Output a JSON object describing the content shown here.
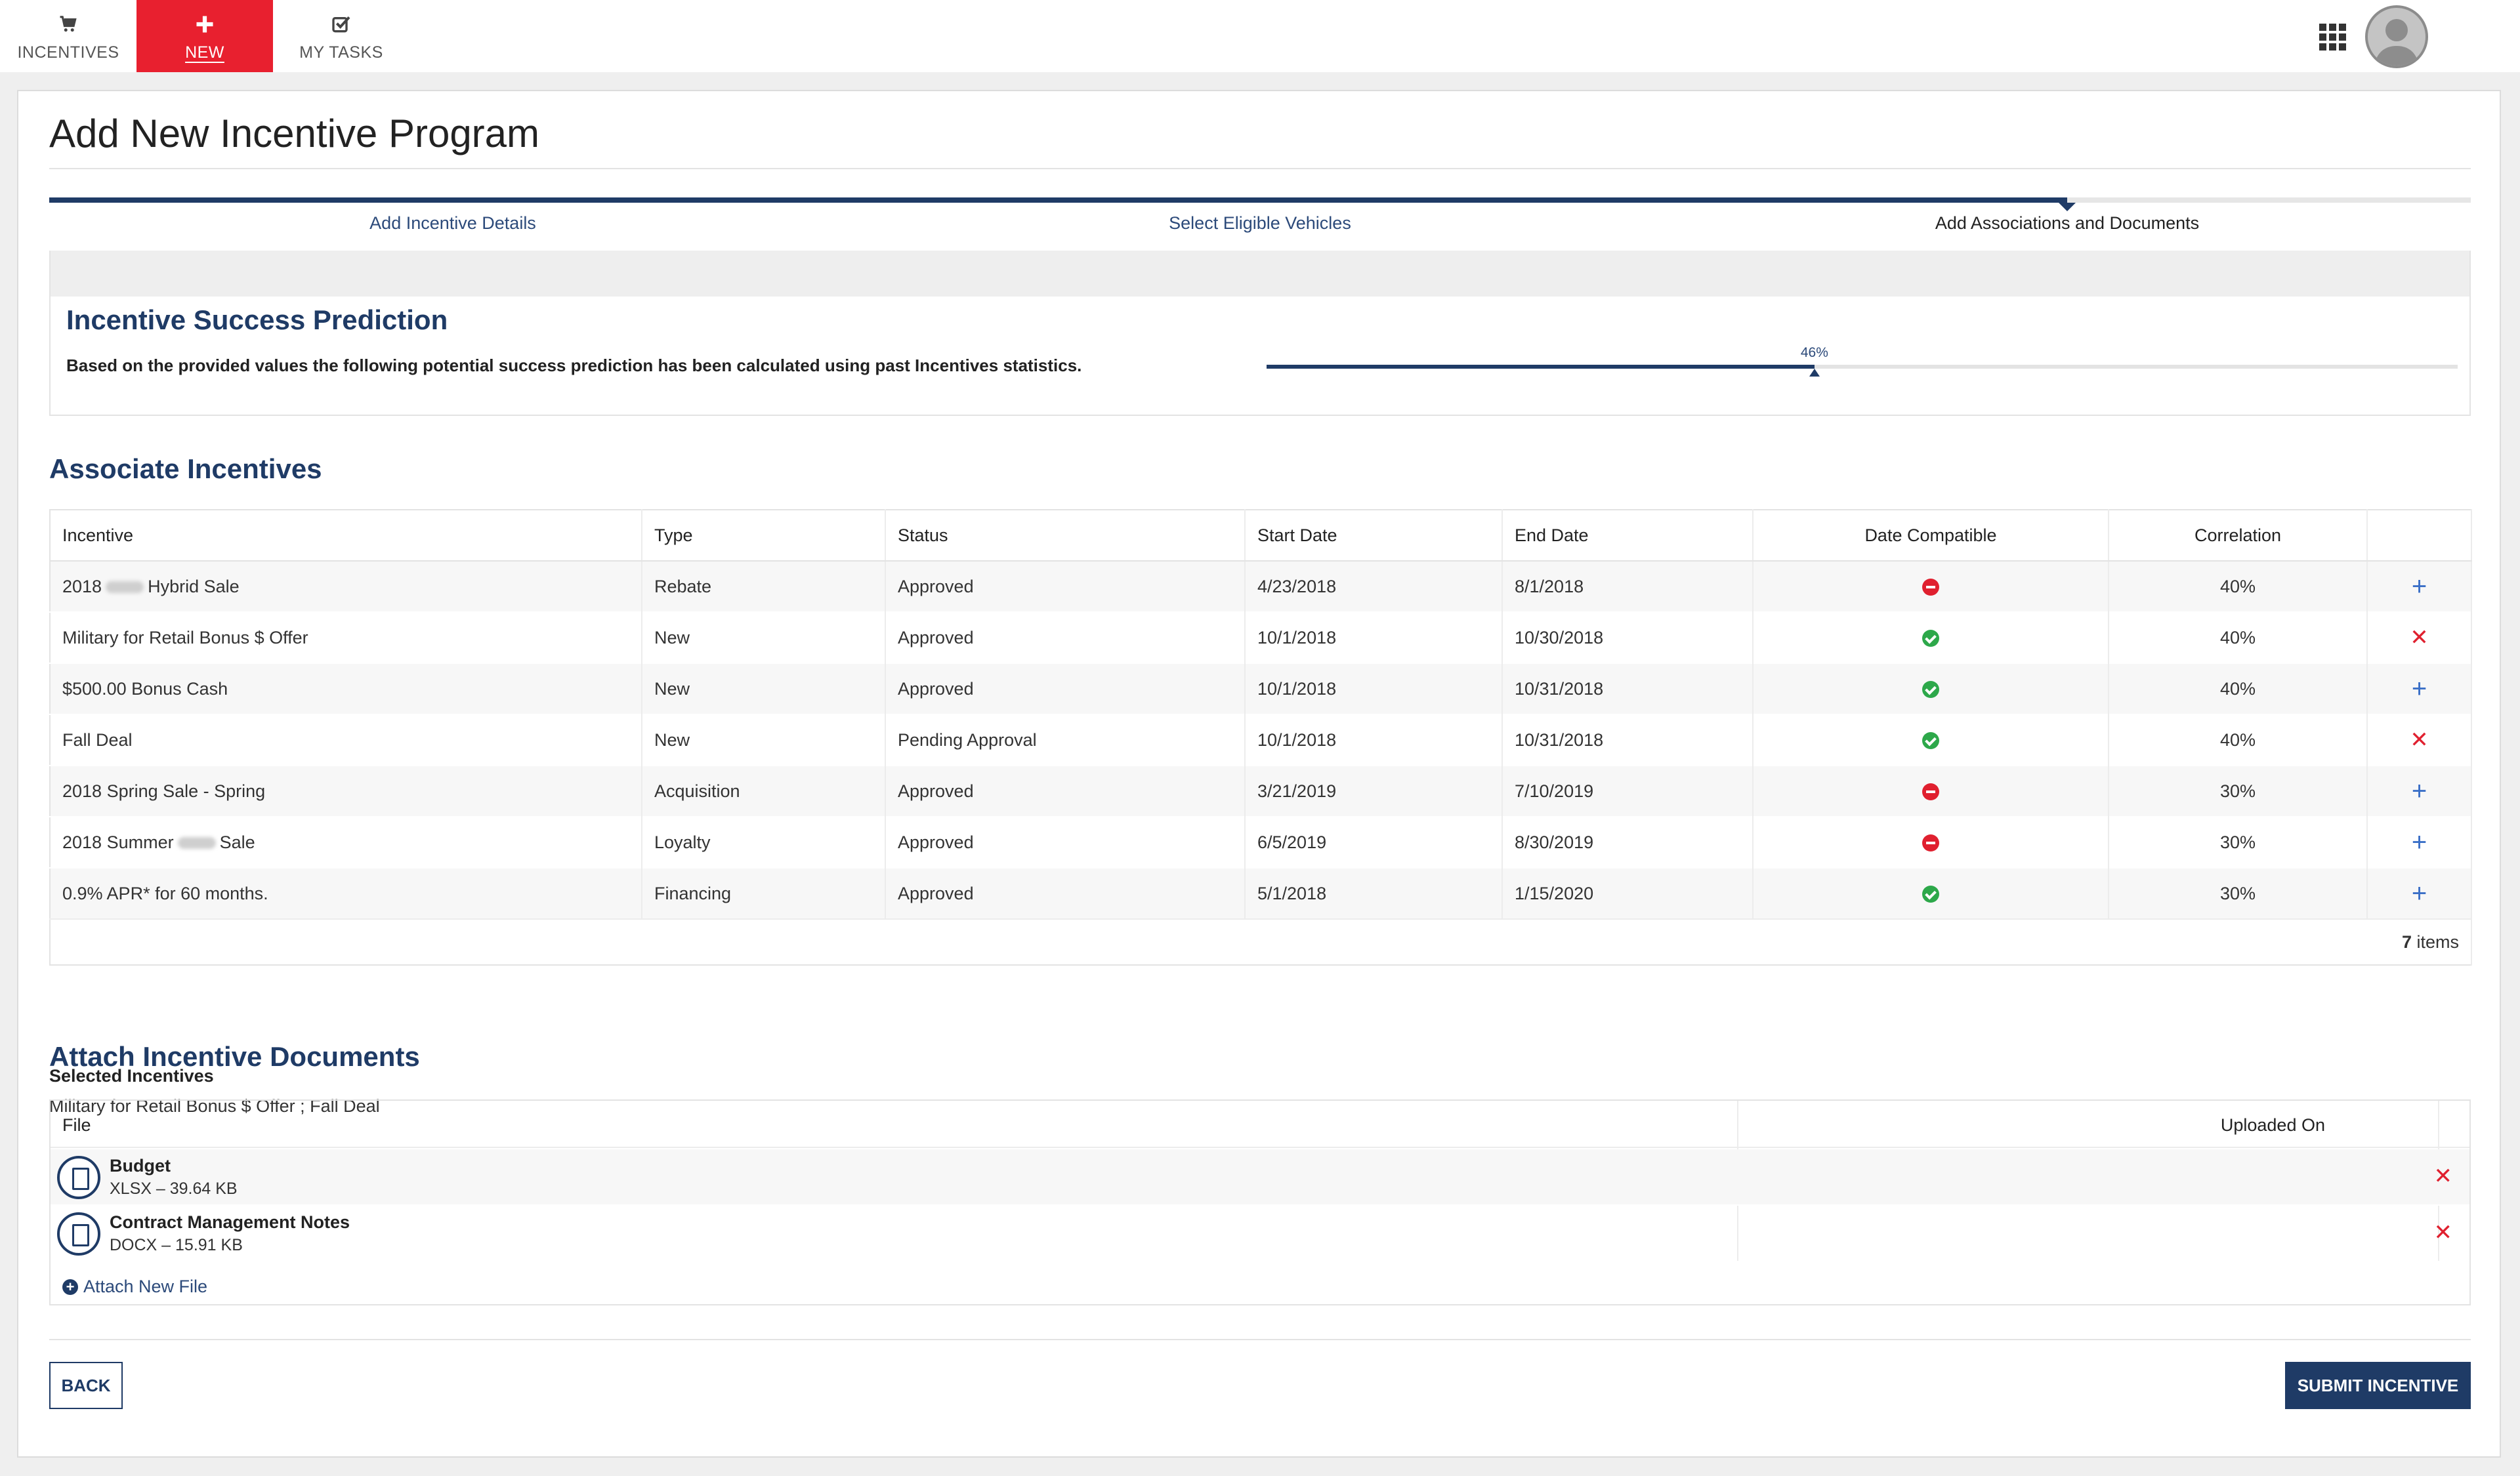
{
  "nav": {
    "tabs": [
      {
        "label": "INCENTIVES",
        "icon": "cart-icon",
        "active": false
      },
      {
        "label": "NEW",
        "icon": "plus-icon",
        "active": true
      },
      {
        "label": "MY TASKS",
        "icon": "checkbox-icon",
        "active": false
      }
    ],
    "apps_icon": "grid-icon",
    "avatar_icon": "user-avatar-icon",
    "accent_color": "#e8202f"
  },
  "page": {
    "title": "Add New Incentive Program"
  },
  "stepper": {
    "steps": [
      "Add Incentive Details",
      "Select Eligible Vehicles",
      "Add Associations and Documents"
    ],
    "current_step": 3
  },
  "prediction": {
    "title": "Incentive Success Prediction",
    "text": "Based on the provided values the following potential success prediction has been calculated using past Incentives statistics.",
    "value_label": "46%",
    "value": 0.46
  },
  "associate": {
    "title": "Associate Incentives",
    "columns": [
      "Incentive",
      "Type",
      "Status",
      "Start Date",
      "End Date",
      "Date Compatible",
      "Correlation",
      ""
    ],
    "rows": [
      {
        "name_prefix": "2018",
        "name_suffix": "Hybrid Sale",
        "redacted": true,
        "type": "Rebate",
        "status": "Approved",
        "start": "4/23/2018",
        "end": "8/1/2018",
        "compatible": false,
        "correlation": "40%",
        "action": "add"
      },
      {
        "name_prefix": "Military for Retail Bonus $ Offer",
        "name_suffix": "",
        "redacted": false,
        "type": "New",
        "status": "Approved",
        "start": "10/1/2018",
        "end": "10/30/2018",
        "compatible": true,
        "correlation": "40%",
        "action": "remove"
      },
      {
        "name_prefix": "$500.00 Bonus Cash",
        "name_suffix": "",
        "redacted": false,
        "type": "New",
        "status": "Approved",
        "start": "10/1/2018",
        "end": "10/31/2018",
        "compatible": true,
        "correlation": "40%",
        "action": "add"
      },
      {
        "name_prefix": "Fall Deal",
        "name_suffix": "",
        "redacted": false,
        "type": "New",
        "status": "Pending Approval",
        "start": "10/1/2018",
        "end": "10/31/2018",
        "compatible": true,
        "correlation": "40%",
        "action": "remove"
      },
      {
        "name_prefix": "2018 Spring Sale - Spring",
        "name_suffix": "",
        "redacted": false,
        "type": "Acquisition",
        "status": "Approved",
        "start": "3/21/2019",
        "end": "7/10/2019",
        "compatible": false,
        "correlation": "30%",
        "action": "add"
      },
      {
        "name_prefix": "2018 Summer",
        "name_suffix": "Sale",
        "redacted": true,
        "type": "Loyalty",
        "status": "Approved",
        "start": "6/5/2019",
        "end": "8/30/2019",
        "compatible": false,
        "correlation": "30%",
        "action": "add"
      },
      {
        "name_prefix": "0.9% APR* for 60 months.",
        "name_suffix": "",
        "redacted": false,
        "type": "Financing",
        "status": "Approved",
        "start": "5/1/2018",
        "end": "1/15/2020",
        "compatible": true,
        "correlation": "30%",
        "action": "add"
      }
    ],
    "count": "7",
    "count_label": "items"
  },
  "selected": {
    "label": "Selected Incentives",
    "value": "Military for Retail Bonus $ Offer ; Fall Deal"
  },
  "documents": {
    "title": "Attach Incentive Documents",
    "col_file": "File",
    "col_uploaded": "Uploaded On",
    "files": [
      {
        "name": "Budget",
        "meta": "XLSX – 39.64 KB"
      },
      {
        "name": "Contract Management Notes",
        "meta": "DOCX – 15.91 KB"
      }
    ],
    "attach_label": "Attach New File"
  },
  "buttons": {
    "back": "BACK",
    "submit": "SUBMIT INCENTIVE"
  }
}
